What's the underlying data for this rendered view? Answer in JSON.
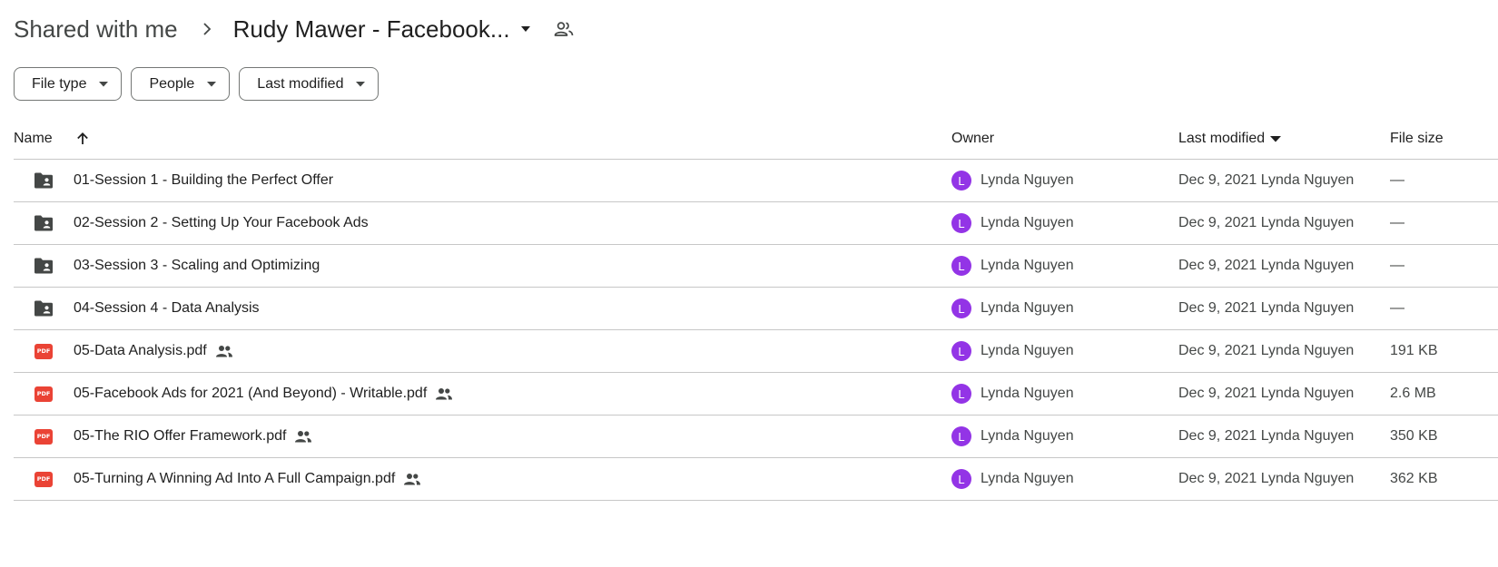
{
  "breadcrumb": {
    "parent": "Shared with me",
    "current": "Rudy Mawer - Facebook..."
  },
  "filters": [
    {
      "label": "File type"
    },
    {
      "label": "People"
    },
    {
      "label": "Last modified"
    }
  ],
  "columns": {
    "name": "Name",
    "owner": "Owner",
    "last_modified": "Last modified",
    "file_size": "File size"
  },
  "colors": {
    "avatar": "#9334e6",
    "pdf": "#ea4335",
    "folder": "#444746"
  },
  "rows": [
    {
      "type": "folder",
      "icon": "shared-folder-icon",
      "name": "01-Session 1 - Building the Perfect Offer",
      "shared": false,
      "owner_initial": "L",
      "owner": "Lynda Nguyen",
      "modified": "Dec 9, 2021 Lynda Nguyen",
      "size": "—"
    },
    {
      "type": "folder",
      "icon": "shared-folder-icon",
      "name": "02-Session 2 - Setting Up Your Facebook Ads",
      "shared": false,
      "owner_initial": "L",
      "owner": "Lynda Nguyen",
      "modified": "Dec 9, 2021 Lynda Nguyen",
      "size": "—"
    },
    {
      "type": "folder",
      "icon": "shared-folder-icon",
      "name": "03-Session 3 - Scaling and Optimizing",
      "shared": false,
      "owner_initial": "L",
      "owner": "Lynda Nguyen",
      "modified": "Dec 9, 2021 Lynda Nguyen",
      "size": "—"
    },
    {
      "type": "folder",
      "icon": "shared-folder-icon",
      "name": "04-Session 4 - Data Analysis",
      "shared": false,
      "owner_initial": "L",
      "owner": "Lynda Nguyen",
      "modified": "Dec 9, 2021 Lynda Nguyen",
      "size": "—"
    },
    {
      "type": "pdf",
      "icon": "pdf-icon",
      "badge": "PDF",
      "name": "05-Data Analysis.pdf",
      "shared": true,
      "owner_initial": "L",
      "owner": "Lynda Nguyen",
      "modified": "Dec 9, 2021 Lynda Nguyen",
      "size": "191 KB"
    },
    {
      "type": "pdf",
      "icon": "pdf-icon",
      "badge": "PDF",
      "name": "05-Facebook Ads for 2021 (And Beyond) - Writable.pdf",
      "shared": true,
      "owner_initial": "L",
      "owner": "Lynda Nguyen",
      "modified": "Dec 9, 2021 Lynda Nguyen",
      "size": "2.6 MB"
    },
    {
      "type": "pdf",
      "icon": "pdf-icon",
      "badge": "PDF",
      "name": "05-The RIO Offer Framework.pdf",
      "shared": true,
      "owner_initial": "L",
      "owner": "Lynda Nguyen",
      "modified": "Dec 9, 2021 Lynda Nguyen",
      "size": "350 KB"
    },
    {
      "type": "pdf",
      "icon": "pdf-icon",
      "badge": "PDF",
      "name": "05-Turning A Winning Ad Into A Full Campaign.pdf",
      "shared": true,
      "owner_initial": "L",
      "owner": "Lynda Nguyen",
      "modified": "Dec 9, 2021 Lynda Nguyen",
      "size": "362 KB"
    }
  ]
}
